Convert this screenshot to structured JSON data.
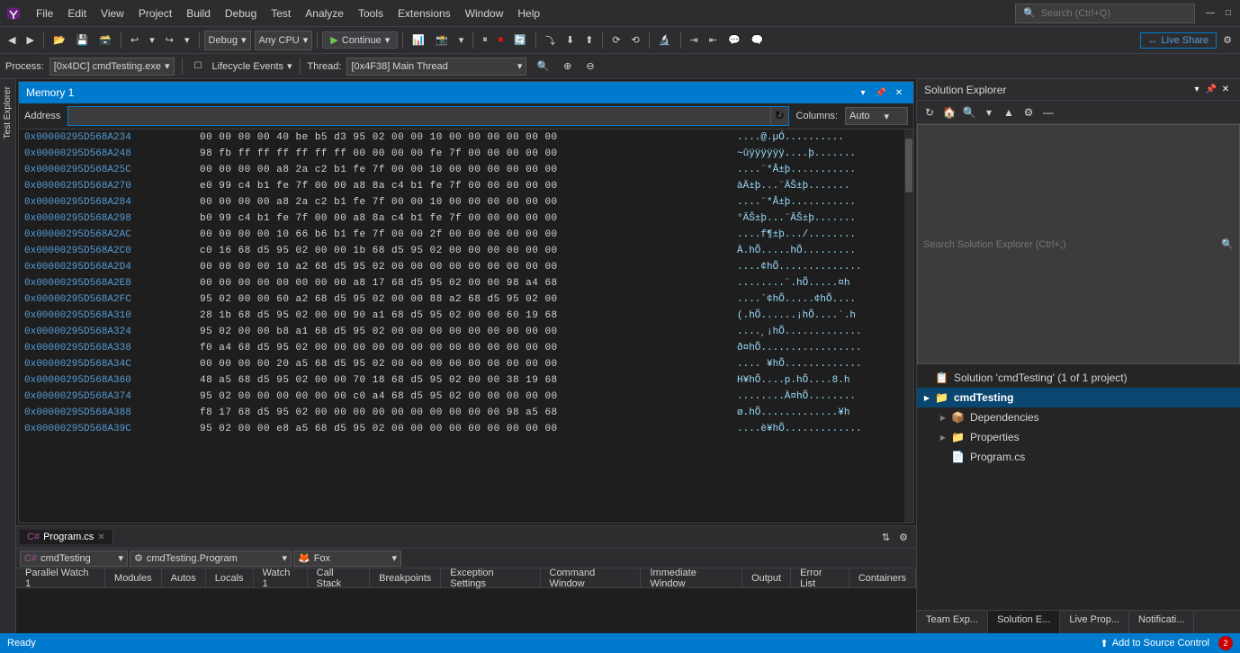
{
  "app": {
    "title": "Visual Studio"
  },
  "menu": {
    "items": [
      "File",
      "Edit",
      "View",
      "Project",
      "Build",
      "Debug",
      "Test",
      "Analyze",
      "Tools",
      "Extensions",
      "Window",
      "Help"
    ],
    "search_placeholder": "Search (Ctrl+Q)"
  },
  "toolbar": {
    "debug_config": "Debug",
    "platform": "Any CPU",
    "continue_label": "Continue",
    "liveshare_label": "Live Share"
  },
  "debug_bar": {
    "process_label": "Process:",
    "process_value": "[0x4DC] cmdTesting.exe",
    "lifecycle_label": "Lifecycle Events",
    "thread_label": "Thread:",
    "thread_value": "[0x4F38] Main Thread"
  },
  "memory_window": {
    "title": "Memory 1",
    "address_label": "Address",
    "address_placeholder": "",
    "columns_label": "Columns:",
    "columns_value": "Auto",
    "rows": [
      {
        "addr": "0x00000295D568A234",
        "bytes": "00 00 00 00 40 be b5 d3 95 02 00 00 10 00 00 00 00 00 00",
        "chars": "....@.µÓ.........."
      },
      {
        "addr": "0x00000295D568A248",
        "bytes": "98 fb ff ff ff ff ff ff 00 00 00 00 fe 7f 00 00 00 00 00",
        "chars": "~ûÿÿÿÿÿÿ....þ......."
      },
      {
        "addr": "0x00000295D568A25C",
        "bytes": "00 00 00 00 a8 2a c2 b1 fe 7f 00 00 10 00 00 00 00 00 00",
        "chars": "....¨*Â±þ..........."
      },
      {
        "addr": "0x00000295D568A270",
        "bytes": "e0 99 c4 b1 fe 7f 00 00 a8 8a c4 b1 fe 7f 00 00 00 00 00",
        "chars": "àÄ±þ...¨ÄŠ±þ......."
      },
      {
        "addr": "0x00000295D568A284",
        "bytes": "00 00 00 00 a8 2a c2 b1 fe 7f 00 00 10 00 00 00 00 00 00",
        "chars": "....¨*Â±þ..........."
      },
      {
        "addr": "0x00000295D568A298",
        "bytes": "b0 99 c4 b1 fe 7f 00 00 a8 8a c4 b1 fe 7f 00 00 00 00 00",
        "chars": "°ÄŠ±þ...¨ÄŠ±þ......."
      },
      {
        "addr": "0x00000295D568A2AC",
        "bytes": "00 00 00 00 10 66 b6 b1 fe 7f 00 00 2f 00 00 00 00 00 00",
        "chars": "....f¶±þ.../........"
      },
      {
        "addr": "0x00000295D568A2C0",
        "bytes": "c0 16 68 d5 95 02 00 00 1b 68 d5 95 02 00 00 00 00 00 00",
        "chars": "À.hÕ.....hÕ........."
      },
      {
        "addr": "0x00000295D568A2D4",
        "bytes": "00 00 00 00 10 a2 68 d5 95 02 00 00 00 00 00 00 00 00 00",
        "chars": "....¢hÕ.............."
      },
      {
        "addr": "0x00000295D568A2E8",
        "bytes": "00 00 00 00 00 00 00 00 a8 17 68 d5 95 02 00 00 98 a4 68",
        "chars": "........¨.hÕ.....¤h"
      },
      {
        "addr": "0x00000295D568A2FC",
        "bytes": "95 02 00 00 60 a2 68 d5 95 02 00 00 88 a2 68 d5 95 02 00",
        "chars": "....`¢hÕ.....¢hÕ...."
      },
      {
        "addr": "0x00000295D568A310",
        "bytes": "28 1b 68 d5 95 02 00 00 90 a1 68 d5 95 02 00 00 60 19 68",
        "chars": "(.hÕ......¡hÕ....`.h"
      },
      {
        "addr": "0x00000295D568A324",
        "bytes": "95 02 00 00 b8 a1 68 d5 95 02 00 00 00 00 00 00 00 00 00",
        "chars": "....¸¡hÕ............."
      },
      {
        "addr": "0x00000295D568A338",
        "bytes": "f0 a4 68 d5 95 02 00 00 00 00 00 00 00 00 00 00 00 00 00",
        "chars": "ð¤hÕ................."
      },
      {
        "addr": "0x00000295D568A34C",
        "bytes": "00 00 00 00 20 a5 68 d5 95 02 00 00 00 00 00 00 00 00 00",
        "chars": ".... ¥hÕ............."
      },
      {
        "addr": "0x00000295D568A360",
        "bytes": "48 a5 68 d5 95 02 00 00 70 18 68 d5 95 02 00 00 38 19 68",
        "chars": "H¥hÕ....p.hÕ....8.h"
      },
      {
        "addr": "0x00000295D568A374",
        "bytes": "95 02 00 00 00 00 00 00 c0 a4 68 d5 95 02 00 00 00 00 00",
        "chars": "........À¤hÕ........"
      },
      {
        "addr": "0x00000295D568A388",
        "bytes": "f8 17 68 d5 95 02 00 00 00 00 00 00 00 00 00 00 98 a5 68",
        "chars": "ø.hÕ.............¥h"
      },
      {
        "addr": "0x00000295D568A39C",
        "bytes": "95 02 00 00 e8 a5 68 d5 95 02 00 00 00 00 00 00 00 00 00",
        "chars": "....è¥hÕ............."
      }
    ]
  },
  "bottom_doc": {
    "tabs": [
      {
        "label": "Program.cs",
        "icon": "cs",
        "active": true,
        "modified": false
      }
    ],
    "nav_left": "cmdTesting",
    "nav_mid": "cmdTesting.Program",
    "nav_right": "Fox"
  },
  "bottom_pane": {
    "tabs": [
      "Parallel Watch 1",
      "Modules",
      "Autos",
      "Locals",
      "Watch 1",
      "Call Stack",
      "Breakpoints",
      "Exception Settings",
      "Command Window",
      "Immediate Window",
      "Output",
      "Error List",
      "Containers"
    ]
  },
  "solution_explorer": {
    "title": "Solution Explorer",
    "search_placeholder": "Search Solution Explorer (Ctrl+;)",
    "tree": [
      {
        "indent": 0,
        "arrow": "",
        "icon": "📋",
        "label": "Solution 'cmdTesting' (1 of 1 project)",
        "level": 0
      },
      {
        "indent": 0,
        "arrow": "▶",
        "icon": "📁",
        "label": "cmdTesting",
        "level": 1,
        "highlighted": true
      },
      {
        "indent": 1,
        "arrow": "▶",
        "icon": "📦",
        "label": "Dependencies",
        "level": 2
      },
      {
        "indent": 1,
        "arrow": "▶",
        "icon": "📁",
        "label": "Properties",
        "level": 2
      },
      {
        "indent": 1,
        "arrow": "",
        "icon": "📄",
        "label": "Program.cs",
        "level": 2
      }
    ],
    "bottom_tabs": [
      "Team Exp...",
      "Solution E...",
      "Live Prop...",
      "Notificati..."
    ]
  },
  "status_bar": {
    "ready_label": "Ready",
    "source_control_label": "Add to Source Control"
  },
  "icons": {
    "search": "🔍",
    "refresh": "↻",
    "close": "✕",
    "pin": "📌",
    "minimize": "—",
    "maximize": "□",
    "chevron_down": "▾",
    "chevron_right": "▶",
    "play": "▶",
    "cs_icon": "C#",
    "folder": "📁"
  }
}
